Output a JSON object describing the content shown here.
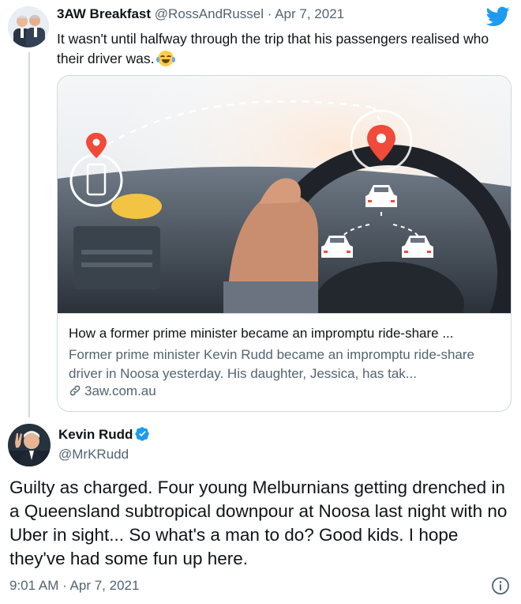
{
  "parent_tweet": {
    "display_name": "3AW Breakfast",
    "handle": "@RossAndRussel",
    "date": "Apr 7, 2021",
    "separator": "·",
    "text": "It wasn't until halfway through the trip that his passengers realised who their driver was.",
    "emoji": "face-with-tears-of-joy",
    "avatar_icon": "two-men-avatar"
  },
  "link_card": {
    "title": "How a former prime minister became an impromptu ride-share ...",
    "description": "Former prime minister Kevin Rudd became an impromptu ride-share driver in Noosa yesterday. His daughter, Jessica, has tak...",
    "domain": "3aw.com.au",
    "image_subject": "hand-on-steering-wheel-with-rideshare-icons"
  },
  "reply_tweet": {
    "display_name": "Kevin Rudd",
    "handle": "@MrKRudd",
    "verified": true,
    "text": "Guilty as charged. Four young Melburnians getting drenched in a Queensland subtropical downpour at Noosa last night with no Uber in sight... So what's a man to do? Good kids. I hope they've had some fun up here.",
    "timestamp": "9:01 AM · Apr 7, 2021"
  },
  "colors": {
    "twitter_blue": "#1d9bf0",
    "muted_text": "#536471",
    "border": "#cfd9de",
    "map_pin": "#f04a3a"
  }
}
